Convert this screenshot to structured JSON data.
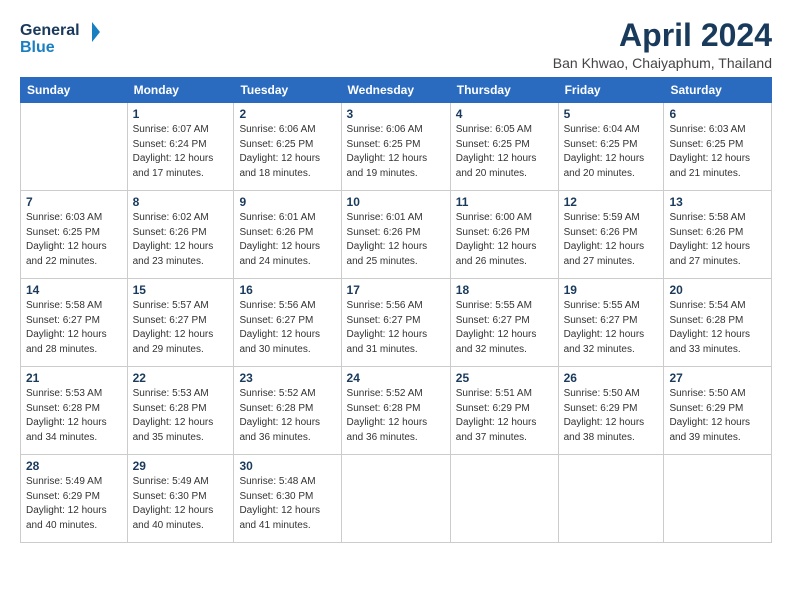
{
  "header": {
    "logo_line1": "General",
    "logo_line2": "Blue",
    "title": "April 2024",
    "subtitle": "Ban Khwao, Chaiyaphum, Thailand"
  },
  "days_of_week": [
    "Sunday",
    "Monday",
    "Tuesday",
    "Wednesday",
    "Thursday",
    "Friday",
    "Saturday"
  ],
  "weeks": [
    [
      {
        "day": "",
        "info": ""
      },
      {
        "day": "1",
        "info": "Sunrise: 6:07 AM\nSunset: 6:24 PM\nDaylight: 12 hours\nand 17 minutes."
      },
      {
        "day": "2",
        "info": "Sunrise: 6:06 AM\nSunset: 6:25 PM\nDaylight: 12 hours\nand 18 minutes."
      },
      {
        "day": "3",
        "info": "Sunrise: 6:06 AM\nSunset: 6:25 PM\nDaylight: 12 hours\nand 19 minutes."
      },
      {
        "day": "4",
        "info": "Sunrise: 6:05 AM\nSunset: 6:25 PM\nDaylight: 12 hours\nand 20 minutes."
      },
      {
        "day": "5",
        "info": "Sunrise: 6:04 AM\nSunset: 6:25 PM\nDaylight: 12 hours\nand 20 minutes."
      },
      {
        "day": "6",
        "info": "Sunrise: 6:03 AM\nSunset: 6:25 PM\nDaylight: 12 hours\nand 21 minutes."
      }
    ],
    [
      {
        "day": "7",
        "info": "Sunrise: 6:03 AM\nSunset: 6:25 PM\nDaylight: 12 hours\nand 22 minutes."
      },
      {
        "day": "8",
        "info": "Sunrise: 6:02 AM\nSunset: 6:26 PM\nDaylight: 12 hours\nand 23 minutes."
      },
      {
        "day": "9",
        "info": "Sunrise: 6:01 AM\nSunset: 6:26 PM\nDaylight: 12 hours\nand 24 minutes."
      },
      {
        "day": "10",
        "info": "Sunrise: 6:01 AM\nSunset: 6:26 PM\nDaylight: 12 hours\nand 25 minutes."
      },
      {
        "day": "11",
        "info": "Sunrise: 6:00 AM\nSunset: 6:26 PM\nDaylight: 12 hours\nand 26 minutes."
      },
      {
        "day": "12",
        "info": "Sunrise: 5:59 AM\nSunset: 6:26 PM\nDaylight: 12 hours\nand 27 minutes."
      },
      {
        "day": "13",
        "info": "Sunrise: 5:58 AM\nSunset: 6:26 PM\nDaylight: 12 hours\nand 27 minutes."
      }
    ],
    [
      {
        "day": "14",
        "info": "Sunrise: 5:58 AM\nSunset: 6:27 PM\nDaylight: 12 hours\nand 28 minutes."
      },
      {
        "day": "15",
        "info": "Sunrise: 5:57 AM\nSunset: 6:27 PM\nDaylight: 12 hours\nand 29 minutes."
      },
      {
        "day": "16",
        "info": "Sunrise: 5:56 AM\nSunset: 6:27 PM\nDaylight: 12 hours\nand 30 minutes."
      },
      {
        "day": "17",
        "info": "Sunrise: 5:56 AM\nSunset: 6:27 PM\nDaylight: 12 hours\nand 31 minutes."
      },
      {
        "day": "18",
        "info": "Sunrise: 5:55 AM\nSunset: 6:27 PM\nDaylight: 12 hours\nand 32 minutes."
      },
      {
        "day": "19",
        "info": "Sunrise: 5:55 AM\nSunset: 6:27 PM\nDaylight: 12 hours\nand 32 minutes."
      },
      {
        "day": "20",
        "info": "Sunrise: 5:54 AM\nSunset: 6:28 PM\nDaylight: 12 hours\nand 33 minutes."
      }
    ],
    [
      {
        "day": "21",
        "info": "Sunrise: 5:53 AM\nSunset: 6:28 PM\nDaylight: 12 hours\nand 34 minutes."
      },
      {
        "day": "22",
        "info": "Sunrise: 5:53 AM\nSunset: 6:28 PM\nDaylight: 12 hours\nand 35 minutes."
      },
      {
        "day": "23",
        "info": "Sunrise: 5:52 AM\nSunset: 6:28 PM\nDaylight: 12 hours\nand 36 minutes."
      },
      {
        "day": "24",
        "info": "Sunrise: 5:52 AM\nSunset: 6:28 PM\nDaylight: 12 hours\nand 36 minutes."
      },
      {
        "day": "25",
        "info": "Sunrise: 5:51 AM\nSunset: 6:29 PM\nDaylight: 12 hours\nand 37 minutes."
      },
      {
        "day": "26",
        "info": "Sunrise: 5:50 AM\nSunset: 6:29 PM\nDaylight: 12 hours\nand 38 minutes."
      },
      {
        "day": "27",
        "info": "Sunrise: 5:50 AM\nSunset: 6:29 PM\nDaylight: 12 hours\nand 39 minutes."
      }
    ],
    [
      {
        "day": "28",
        "info": "Sunrise: 5:49 AM\nSunset: 6:29 PM\nDaylight: 12 hours\nand 40 minutes."
      },
      {
        "day": "29",
        "info": "Sunrise: 5:49 AM\nSunset: 6:30 PM\nDaylight: 12 hours\nand 40 minutes."
      },
      {
        "day": "30",
        "info": "Sunrise: 5:48 AM\nSunset: 6:30 PM\nDaylight: 12 hours\nand 41 minutes."
      },
      {
        "day": "",
        "info": ""
      },
      {
        "day": "",
        "info": ""
      },
      {
        "day": "",
        "info": ""
      },
      {
        "day": "",
        "info": ""
      }
    ]
  ]
}
